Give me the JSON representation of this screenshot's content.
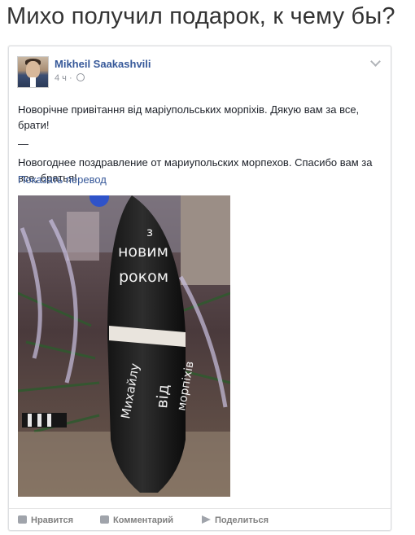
{
  "headline": "Михо получил подарок, к чему бы?",
  "post": {
    "author": "Mikheil Saakashvili",
    "time": "4 ч",
    "separator": "·",
    "text_ua": "Новорічне привітання від маріупольських морпіхів. Дякую вам за все, брати!",
    "divider": "—",
    "text_ru": "Новогоднее поздравление от мариупольских морпехов. Спасибо вам за все, братья!",
    "translate_link": "Показать перевод",
    "photo": {
      "inscription_top_line1": "з",
      "inscription_top_line2": "новим",
      "inscription_top_line3": "роком",
      "inscription_side1": "Михайлу",
      "inscription_side2": "від",
      "inscription_side3": "морпіхів"
    }
  },
  "actions": {
    "like": "Нравится",
    "comment": "Комментарий",
    "share": "Поделиться"
  },
  "icons": {
    "like": "thumbs-up-icon",
    "comment": "speech-bubble-icon",
    "share": "share-arrow-icon",
    "privacy": "globe-icon",
    "menu": "chevron-down-icon"
  },
  "colors": {
    "link": "#365899",
    "text": "#1d2129",
    "meta": "#90949c"
  }
}
